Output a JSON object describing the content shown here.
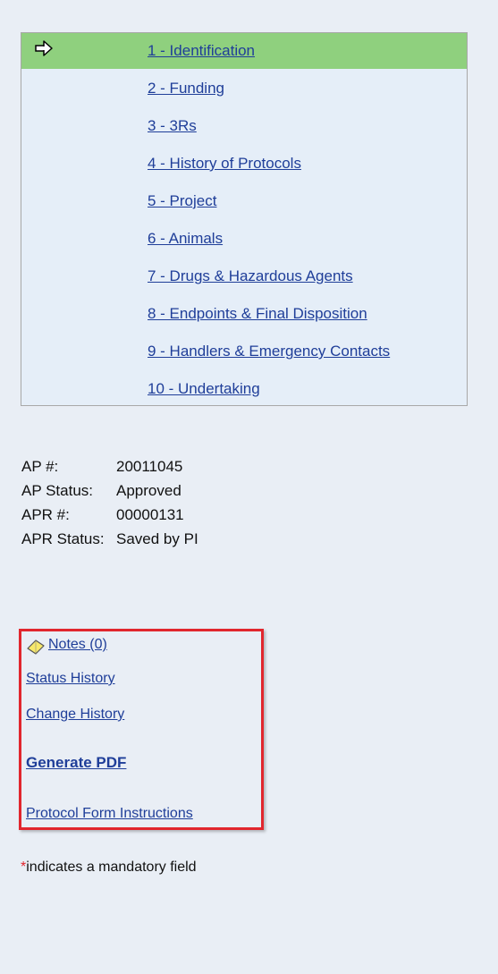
{
  "nav": {
    "items": [
      {
        "label": "1 - Identification",
        "current": true
      },
      {
        "label": "2 - Funding"
      },
      {
        "label": "3 - 3Rs"
      },
      {
        "label": "4 - History of Protocols"
      },
      {
        "label": "5 - Project"
      },
      {
        "label": "6 - Animals"
      },
      {
        "label": "7 - Drugs & Hazardous Agents"
      },
      {
        "label": "8 - Endpoints & Final Disposition"
      },
      {
        "label": "9 - Handlers & Emergency Contacts"
      },
      {
        "label": "10 - Undertaking"
      }
    ],
    "current_icon": "arrow-right-icon",
    "current_color": "#8fd07e"
  },
  "info": {
    "ap_number_label": "AP #:",
    "ap_number_value": "20011045",
    "ap_status_label": "AP Status:",
    "ap_status_value": "Approved",
    "apr_number_label": "APR #:",
    "apr_number_value": "00000131",
    "apr_status_label": "APR Status:",
    "apr_status_value": "Saved by PI"
  },
  "links": {
    "notes_label": "Notes (0)",
    "notes_icon": "note-icon",
    "status_history_label": "Status History",
    "change_history_label": "Change History",
    "generate_pdf_label": "Generate PDF",
    "instructions_label": "Protocol Form Instructions",
    "highlight_color": "#e1262d"
  },
  "footnote": {
    "star": "*",
    "text": "indicates a mandatory field"
  }
}
